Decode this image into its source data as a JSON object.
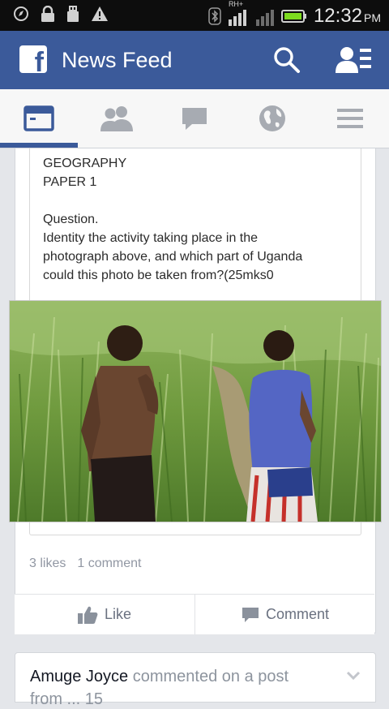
{
  "status_bar": {
    "time": "12:32",
    "ampm": "PM",
    "signal_label": "RH+",
    "icons": [
      "compass-icon",
      "lock-icon",
      "usb-icon",
      "warning-icon",
      "bluetooth-icon",
      "signal-icon",
      "battery-icon"
    ]
  },
  "app_bar": {
    "logo": "f",
    "title": "News Feed",
    "icons": [
      "search-icon",
      "friend-requests-icon"
    ]
  },
  "tabs": [
    {
      "name": "news-feed",
      "icon": "news-feed-icon",
      "active": true
    },
    {
      "name": "friends",
      "icon": "friends-icon",
      "active": false
    },
    {
      "name": "messages",
      "icon": "chat-icon",
      "active": false
    },
    {
      "name": "notifications",
      "icon": "globe-icon",
      "active": false
    },
    {
      "name": "more",
      "icon": "menu-icon",
      "active": false
    }
  ],
  "post": {
    "lines": [
      "GEOGRAPHY",
      "PAPER 1",
      "",
      "Question.",
      "Identity the activity taking place in the",
      "photograph above, and which part of Uganda",
      "could this photo be taken from?(25mks0"
    ],
    "likes": "3 likes",
    "comments": "1 comment",
    "like_label": "Like",
    "comment_label": "Comment"
  },
  "next_story": {
    "author": "Amuge Joyce",
    "action": "commented on a post",
    "line2": "from ... 15"
  },
  "colors": {
    "brand": "#3b5a9a",
    "status_bar": "#0d0d0d",
    "battery": "#7ddc1f",
    "feed_bg": "#e4e6ea",
    "muted_text": "#9197a3"
  }
}
